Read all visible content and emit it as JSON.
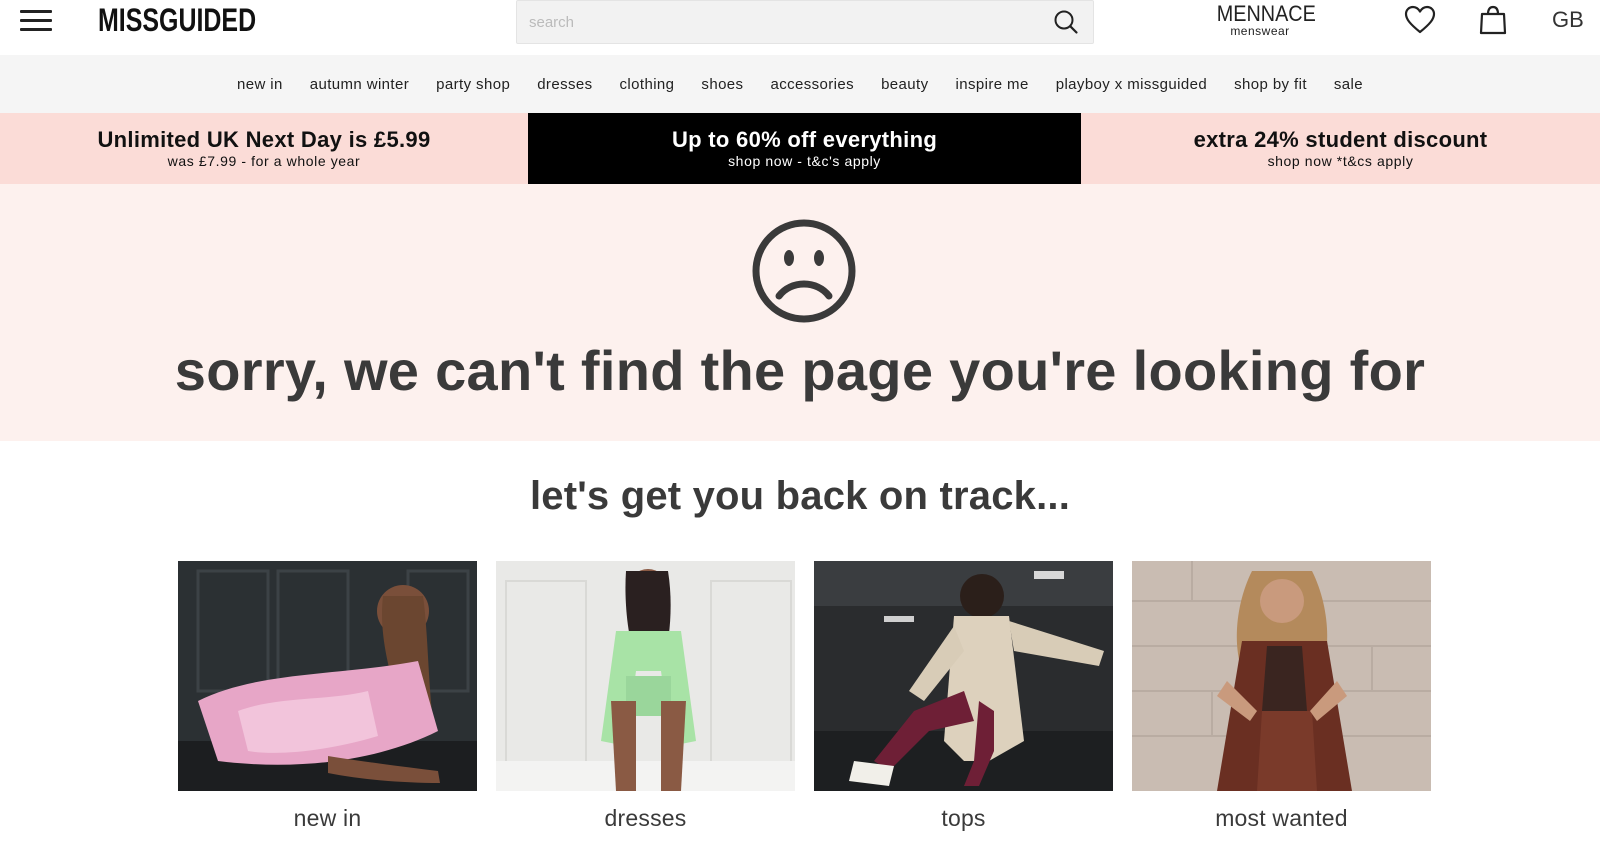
{
  "header": {
    "logo": "MISSGUIDED",
    "search_placeholder": "search",
    "menswear_brand": "MENNACE",
    "menswear_sub": "menswear",
    "region": "GB"
  },
  "nav": {
    "items": [
      "new in",
      "autumn winter",
      "party shop",
      "dresses",
      "clothing",
      "shoes",
      "accessories",
      "beauty",
      "inspire me",
      "playboy x missguided",
      "shop by fit",
      "sale"
    ]
  },
  "promos": [
    {
      "title": "Unlimited UK Next Day is £5.99",
      "subtitle": "was £7.99 - for a whole year"
    },
    {
      "title": "Up to 60% off everything",
      "subtitle": "shop now - t&c's apply"
    },
    {
      "title": "extra 24% student discount",
      "subtitle": "shop now *t&cs apply"
    }
  ],
  "error": {
    "icon": "sad-face-icon",
    "message": "sorry, we can't find the page you're looking for"
  },
  "recovery": {
    "heading": "let's get you back on track...",
    "cards": [
      {
        "label": "new in",
        "image": "model in pink dress reclining"
      },
      {
        "label": "dresses",
        "image": "model in green satin co-ord"
      },
      {
        "label": "tops",
        "image": "model in quilted cream coat"
      },
      {
        "label": "most wanted",
        "image": "model in brown leather coat"
      }
    ]
  },
  "colors": {
    "promo_pink": "#fbdcd7",
    "promo_black": "#000000",
    "hero_bg": "#fdf1ee",
    "nav_bg": "#f5f5f5",
    "text_dark": "#3a3a3a"
  }
}
